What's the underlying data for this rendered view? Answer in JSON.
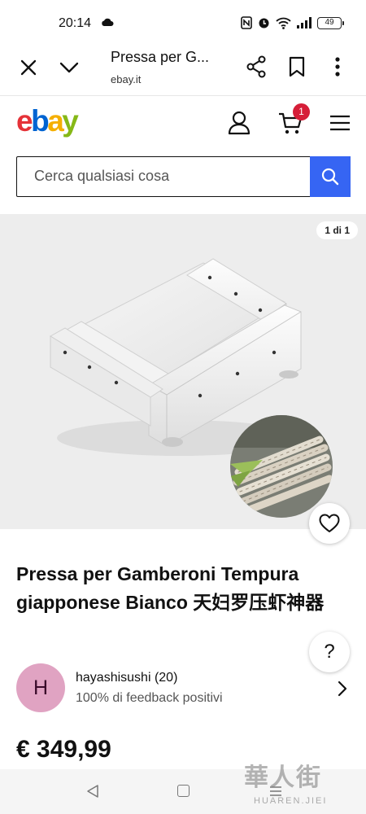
{
  "status_bar": {
    "time": "20:14",
    "battery": "49"
  },
  "browser": {
    "title": "Pressa per G...",
    "url": "ebay.it"
  },
  "header": {
    "logo": {
      "e": "e",
      "b": "b",
      "a": "a",
      "y": "y"
    },
    "cart_count": "1"
  },
  "search": {
    "placeholder": "Cerca qualsiasi cosa"
  },
  "gallery": {
    "counter": "1 di 1"
  },
  "product": {
    "title": "Pressa per Gamberoni Tempura giapponese Bianco 天妇罗压虾神器",
    "price": "€ 349,99"
  },
  "help": {
    "label": "?"
  },
  "seller": {
    "initial": "H",
    "name": "hayashisushi (20)",
    "feedback": "100% di feedback positivi"
  },
  "watermark": {
    "main": "華人街",
    "sub": "HUAREN.JIEI"
  },
  "colors": {
    "ebay_red": "#e53238",
    "ebay_blue": "#0064d2",
    "ebay_yellow": "#f5af02",
    "ebay_green": "#86b817",
    "search_button": "#3665f3",
    "cart_badge": "#d61e38",
    "avatar": "#e0a3c2"
  },
  "icons": {
    "status": [
      "cloud-icon",
      "nfc-icon",
      "alarm-icon",
      "wifi-icon",
      "signal-icon",
      "battery-icon"
    ],
    "browser": [
      "close-icon",
      "chevron-down-icon",
      "share-icon",
      "bookmark-icon",
      "more-vertical-icon"
    ],
    "header": [
      "user-icon",
      "cart-icon",
      "menu-icon"
    ],
    "other": [
      "search-icon",
      "heart-icon",
      "chevron-right-icon",
      "nav-back-icon",
      "nav-home-icon",
      "nav-recent-icon"
    ]
  }
}
